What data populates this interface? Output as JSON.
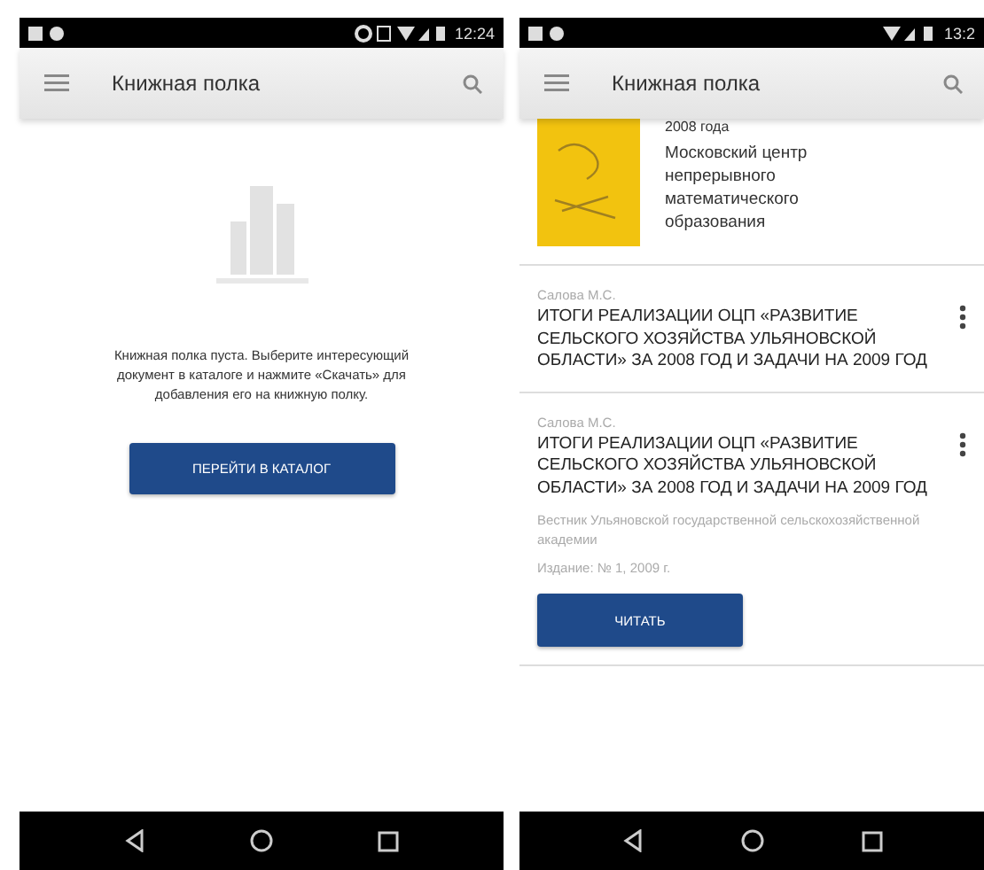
{
  "left_screen": {
    "status_bar": {
      "time": "12:24"
    },
    "app_bar": {
      "title": "Книжная полка"
    },
    "empty_state": {
      "message": "Книжная полка пуста. Выберите интересующий документ в каталоге и нажмите «Скачать» для добавления его на книжную полку.",
      "button": "ПЕРЕЙТИ В КАТАЛОГ"
    }
  },
  "right_screen": {
    "status_bar": {
      "time": "13:2"
    },
    "app_bar": {
      "title": "Книжная полка"
    },
    "items": [
      {
        "kind": "cover",
        "title": "2008 года",
        "publisher": "Московский центр непрерывного математического образования"
      },
      {
        "kind": "article",
        "author": "Салова М.С.",
        "title": "ИТОГИ РЕАЛИЗАЦИИ ОЦП «РАЗВИТИЕ СЕЛЬСКОГО ХОЗЯЙСТВА УЛЬЯНОВСКОЙ ОБЛАСТИ» ЗА 2008 ГОД И ЗАДАЧИ НА 2009 ГОД"
      },
      {
        "kind": "article",
        "author": "Салова М.С.",
        "title": "ИТОГИ РЕАЛИЗАЦИИ ОЦП «РАЗВИТИЕ СЕЛЬСКОГО ХОЗЯЙСТВА УЛЬЯНОВСКОЙ ОБЛАСТИ» ЗА 2008 ГОД И ЗАДАЧИ НА 2009 ГОД",
        "journal": "Вестник Ульяновской государственной сельскохозяйственной академии",
        "issue": "Издание: № 1, 2009 г.",
        "button": "ЧИТАТЬ"
      }
    ]
  }
}
